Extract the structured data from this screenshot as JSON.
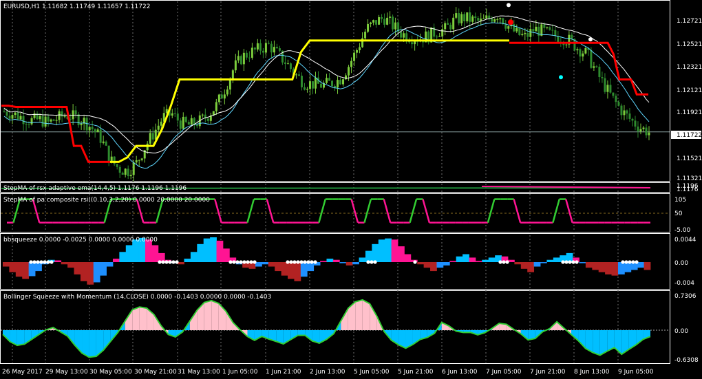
{
  "chart_data": [
    {
      "type": "candlestick",
      "title": "EURUSD,H1  1.11682 1.11749 1.11657 1.11722",
      "symbol": "EURUSD,H1",
      "ohlc": [
        "1.11682",
        "1.11749",
        "1.11657",
        "1.11722"
      ],
      "y_ticks": [
        "1.12721",
        "1.12521",
        "1.12321",
        "1.12121",
        "1.11921",
        "1.11722",
        "1.11521",
        "1.11321"
      ],
      "ylim": [
        1.113,
        1.1285
      ],
      "current_price": "1.11722",
      "colors": {
        "bull": "#7ccd3c",
        "bear": "#2e8b2e",
        "step_red": "#ff0000",
        "step_yellow": "#ffff00",
        "cyan_line": "#5fd7ff",
        "white_line": "#ffffff"
      },
      "series": [
        {
          "name": "price_close",
          "values": [
            1.119,
            1.1188,
            1.1185,
            1.1182,
            1.1183,
            1.118,
            1.1184,
            1.1187,
            1.1185,
            1.1182,
            1.1175,
            1.1166,
            1.1148,
            1.114,
            1.1138,
            1.1145,
            1.116,
            1.1172,
            1.1185,
            1.1188,
            1.118,
            1.1178,
            1.1181,
            1.1186,
            1.1195,
            1.121,
            1.1228,
            1.1238,
            1.1242,
            1.1245,
            1.1248,
            1.124,
            1.1232,
            1.1222,
            1.1215,
            1.1214,
            1.1213,
            1.1215,
            1.1218,
            1.123,
            1.1245,
            1.1262,
            1.1268,
            1.1272,
            1.1265,
            1.1258,
            1.1255,
            1.1254,
            1.1256,
            1.126,
            1.1262,
            1.127,
            1.1272,
            1.127,
            1.1268,
            1.1272,
            1.1275,
            1.1265,
            1.1258,
            1.1255,
            1.1262,
            1.126,
            1.1257,
            1.1255,
            1.1252,
            1.1245,
            1.124,
            1.1225,
            1.1212,
            1.12,
            1.119,
            1.1182,
            1.1176,
            1.1172
          ]
        },
        {
          "name": "stepma_red_top",
          "values": [
            1.1195,
            1.1195,
            1.1194,
            1.1194,
            1.1194,
            1.1194,
            1.1194,
            1.1194,
            1.1194,
            1.1194,
            1.116,
            1.116,
            1.1146,
            1.1146,
            1.1146,
            1.1146
          ]
        },
        {
          "name": "stepma_yellow",
          "values": [
            1.1146,
            1.1146,
            1.115,
            1.116,
            1.116,
            1.116,
            1.1175,
            1.1195,
            1.1218,
            1.1218,
            1.1218,
            1.1218,
            1.1218,
            1.1218,
            1.1218,
            1.1218,
            1.1218,
            1.1218,
            1.1218,
            1.1218,
            1.1218,
            1.1218,
            1.1242,
            1.1252,
            1.1252,
            1.1252,
            1.1252,
            1.1252,
            1.1252,
            1.1252,
            1.1252,
            1.1252,
            1.1252,
            1.1252,
            1.1252,
            1.1252,
            1.1252,
            1.1252,
            1.1252,
            1.1252,
            1.1252,
            1.1252,
            1.1252,
            1.1252,
            1.1252,
            1.1252,
            1.1252
          ]
        },
        {
          "name": "stepma_red_bottom",
          "values": [
            1.125,
            1.125,
            1.125,
            1.125,
            1.125,
            1.125,
            1.125,
            1.125,
            1.125,
            1.125,
            1.125,
            1.125,
            1.125,
            1.125,
            1.125,
            1.125,
            1.125,
            1.125,
            1.124,
            1.1218,
            1.1218,
            1.1218,
            1.1205,
            1.1205,
            1.1205
          ]
        }
      ],
      "markers": {
        "red_dot": [
          1.1268
        ],
        "white_dots": [
          1.1283,
          1.1253
        ],
        "cyan_dot": [
          1.122
        ]
      }
    },
    {
      "type": "line",
      "title": "StepMA of rsx adaptive ema(14,4,5) 1.1176 1.1196 1.1196",
      "y_ticks": [
        "1.1196",
        "1.1176"
      ]
    },
    {
      "type": "line",
      "title": "StepMA of pa composite rsi((0.10,3,2,20) 0.0000 20.0000 20.0000",
      "y_ticks": [
        "105",
        "50",
        "-5.00"
      ],
      "ylim": [
        -5,
        105
      ],
      "series": [
        {
          "name": "step",
          "values": [
            20,
            20,
            95,
            95,
            95,
            20,
            20,
            20,
            20,
            20,
            20,
            20,
            20,
            20,
            20,
            20,
            95,
            95,
            95,
            95,
            95,
            20,
            20,
            20,
            95,
            95,
            95,
            95,
            95,
            95,
            95,
            95,
            95,
            20,
            20,
            20,
            20,
            20,
            95,
            95,
            95,
            20,
            20,
            20,
            20,
            20,
            20,
            20,
            20,
            95,
            95,
            95,
            95,
            95,
            20,
            20,
            95,
            95,
            95,
            20,
            20,
            20,
            20,
            95,
            95,
            20,
            20,
            20,
            20,
            20,
            20,
            20,
            20,
            20,
            20,
            95,
            95,
            95,
            95,
            20,
            20,
            20,
            20,
            20,
            20,
            95,
            95,
            20,
            20,
            20,
            20,
            20,
            20,
            20,
            20,
            20,
            20,
            20,
            20,
            20
          ]
        }
      ]
    },
    {
      "type": "bar",
      "title": "bbsqueeze 0.0000 -0.0025 0.0000 0.0000 0.0000",
      "y_ticks": [
        "0.0044",
        "0.00",
        "-0.004"
      ],
      "ylim": [
        -0.0048,
        0.0044
      ],
      "colors": {
        "pos_strong": "#00bfff",
        "pos_weak": "#ff1493",
        "neg_strong": "#1e90ff",
        "neg_weak": "#b22222",
        "squeeze_dot": "#ffffff"
      },
      "series": [
        {
          "name": "histogram",
          "values": [
            -0.0008,
            -0.0018,
            -0.0026,
            -0.003,
            -0.0025,
            -0.0016,
            -0.0004,
            0.0004,
            0.0003,
            -0.0004,
            -0.001,
            -0.0022,
            -0.0034,
            -0.004,
            -0.0036,
            -0.0024,
            -0.0008,
            0.0006,
            0.0018,
            0.003,
            0.004,
            0.0043,
            0.004,
            0.003,
            0.0016,
            0.0004,
            -0.0002,
            -0.0004,
            0.0006,
            0.0018,
            0.0032,
            0.0042,
            0.0044,
            0.0038,
            0.0024,
            0.0008,
            -0.0004,
            -0.001,
            -0.0012,
            -0.0008,
            -0.0004,
            -0.0008,
            -0.0016,
            -0.0024,
            -0.003,
            -0.0034,
            -0.0026,
            -0.0016,
            -0.0006,
            0.0002,
            0.0006,
            0.0004,
            -0.0002,
            -0.0006,
            -0.0004,
            0.0008,
            0.002,
            0.0032,
            0.004,
            0.0042,
            0.004,
            0.0028,
            0.0014,
            0.0004,
            -0.0004,
            -0.001,
            -0.0016,
            -0.001,
            -0.0006,
            0.0002,
            0.001,
            0.0014,
            0.0008,
            0.0002,
            0.0004,
            0.0008,
            0.0012,
            0.001,
            0.0004,
            -0.0004,
            -0.0012,
            -0.0018,
            -0.0008,
            -0.0002,
            0.0004,
            0.0008,
            0.0012,
            0.0016,
            0.0008,
            -0.0002,
            -0.001,
            -0.0014,
            -0.0018,
            -0.0022,
            -0.0024,
            -0.0022,
            -0.0018,
            -0.0014,
            -0.001,
            -0.0014
          ]
        }
      ]
    },
    {
      "type": "area",
      "title": "Bollinger Squeeze with Momentum (14,CLOSE) 0.0000 -0.1403 0.0000 0.0000 -0.1403",
      "y_ticks": [
        "0.7306",
        "0.00",
        "-0.6308"
      ],
      "ylim": [
        -0.6308,
        0.7306
      ],
      "colors": {
        "pos": "#ffc0cb",
        "neg": "#00bfff",
        "line": "#32cd32"
      },
      "series": [
        {
          "name": "momentum",
          "values": [
            -0.1,
            -0.22,
            -0.32,
            -0.3,
            -0.18,
            -0.08,
            0.02,
            0.05,
            -0.02,
            -0.12,
            -0.3,
            -0.48,
            -0.56,
            -0.52,
            -0.4,
            -0.22,
            -0.05,
            0.2,
            0.45,
            0.52,
            0.5,
            0.34,
            0.1,
            -0.08,
            -0.14,
            -0.04,
            0.2,
            0.45,
            0.62,
            0.66,
            0.6,
            0.42,
            0.18,
            0.02,
            -0.12,
            -0.2,
            -0.14,
            -0.18,
            -0.22,
            -0.28,
            -0.2,
            -0.1,
            -0.12,
            -0.22,
            -0.28,
            -0.2,
            -0.06,
            0.2,
            0.48,
            0.64,
            0.66,
            0.58,
            0.3,
            -0.04,
            -0.2,
            -0.3,
            -0.36,
            -0.28,
            -0.2,
            -0.14,
            -0.06,
            0.18,
            0.1,
            -0.02,
            -0.06,
            -0.06,
            -0.08,
            -0.05,
            0.04,
            0.16,
            0.14,
            0.02,
            -0.08,
            -0.2,
            -0.16,
            -0.04,
            0.02,
            0.2,
            0.04,
            -0.1,
            -0.22,
            -0.36,
            -0.46,
            -0.5,
            -0.42,
            -0.36,
            -0.48,
            -0.4,
            -0.3,
            -0.2,
            -0.14
          ]
        }
      ]
    }
  ],
  "time_axis": [
    "26 May 2017",
    "29 May 13:00",
    "30 May 05:00",
    "30 May 21:00",
    "31 May 13:00",
    "1 Jun 05:00",
    "1 Jun 21:00",
    "2 Jun 13:00",
    "5 Jun 05:00",
    "5 Jun 21:00",
    "6 Jun 13:00",
    "7 Jun 05:00",
    "7 Jun 21:00",
    "8 Jun 13:00",
    "9 Jun 05:00"
  ]
}
